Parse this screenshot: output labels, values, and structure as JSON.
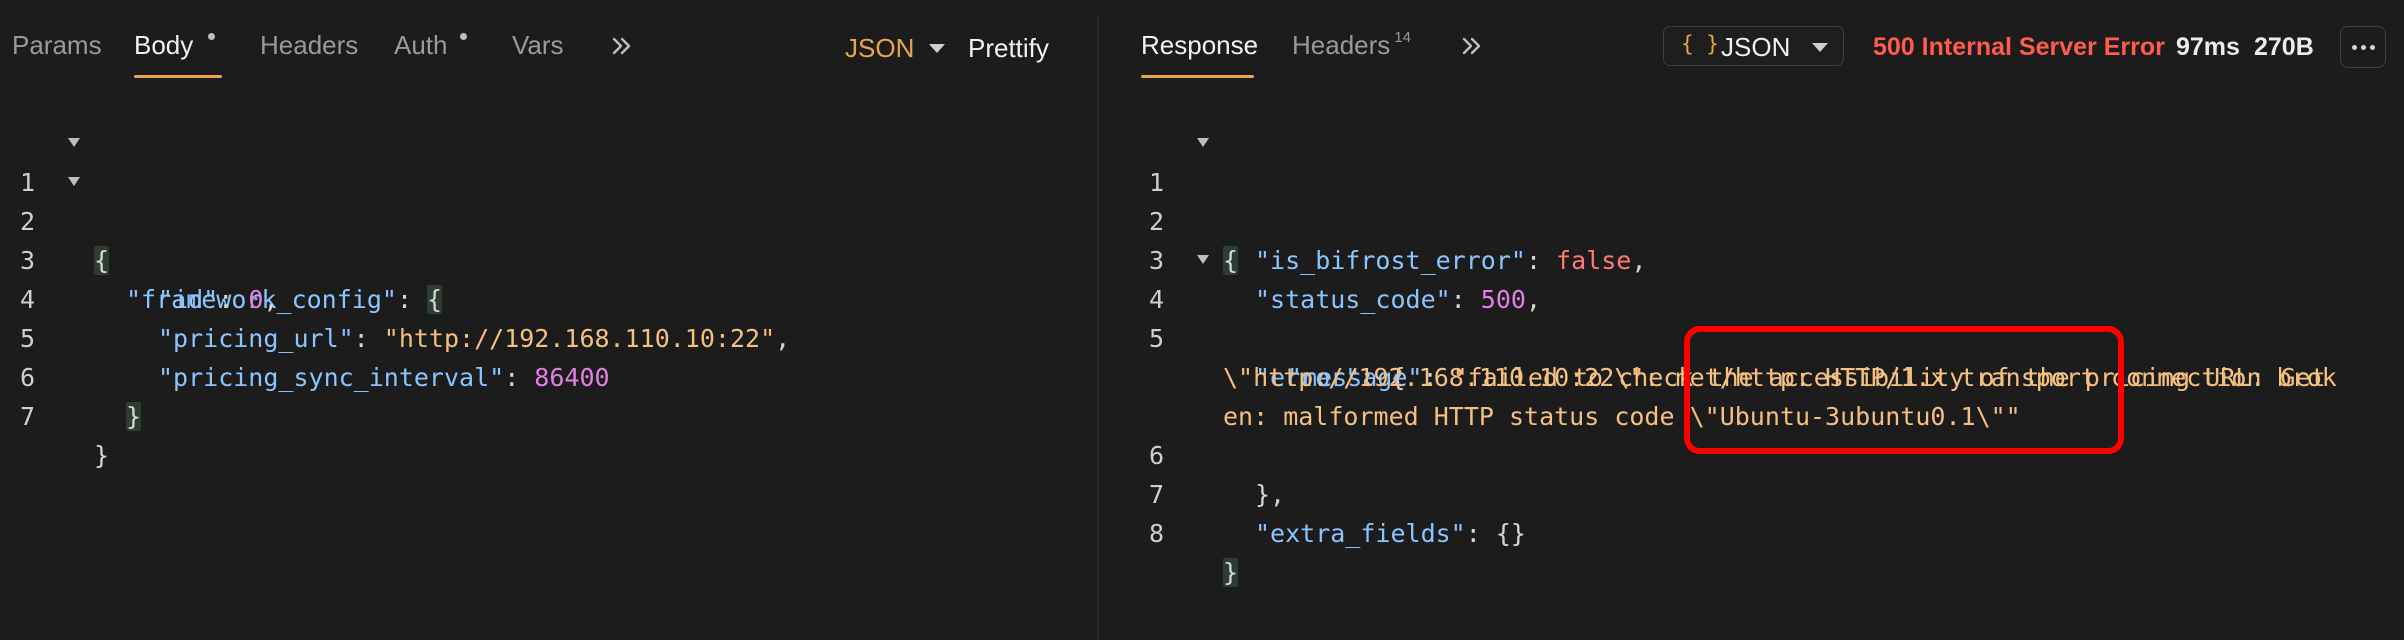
{
  "request": {
    "tabs": [
      "Params",
      "Body",
      "Headers",
      "Auth",
      "Vars"
    ],
    "format": "JSON",
    "prettify": "Prettify"
  },
  "response": {
    "tabs": [
      "Response",
      "Headers"
    ],
    "headers_count": "14",
    "format_icon": "{ }",
    "format": "JSON",
    "status": "500 Internal Server Error",
    "time": "97ms",
    "size": "270B"
  },
  "request_body": {
    "line_numbers": [
      "1",
      "2",
      "3",
      "4",
      "5",
      "6",
      "7"
    ],
    "framework_config_key": "\"framework_config\"",
    "id_key": "\"id\"",
    "id_value": "0",
    "pricing_url_key": "\"pricing_url\"",
    "pricing_url_value": "\"http://192.168.110.10:22\"",
    "sync_interval_key": "\"pricing_sync_interval\"",
    "sync_interval_value": "86400"
  },
  "response_body": {
    "line_numbers": [
      "1",
      "2",
      "3",
      "4",
      "5",
      "6",
      "7",
      "8"
    ],
    "is_bifrost_error_key": "\"is_bifrost_error\"",
    "is_bifrost_error_value": "false",
    "status_code_key": "\"status_code\"",
    "status_code_value": "500",
    "error_key": "\"error\"",
    "message_key": "\"message\"",
    "message_line1": "\"failed to check the accessibility of the pricing URL: Get",
    "message_line2": "\\\"http://192.168.110.10:22\\\": net/http: HTTP/1.x transport connection brok",
    "message_line3": "en: malformed HTTP status code \\\"Ubuntu-3ubuntu0.1\\\"\"",
    "extra_fields_key": "\"extra_fields\"",
    "extra_fields_value": "{}"
  },
  "colors": {
    "accent": "#e8a54b",
    "error": "#ff5c4d",
    "key": "#8cc4ff",
    "string": "#f4c07f",
    "number": "#e37fe3",
    "annotation": "#ff0000"
  }
}
